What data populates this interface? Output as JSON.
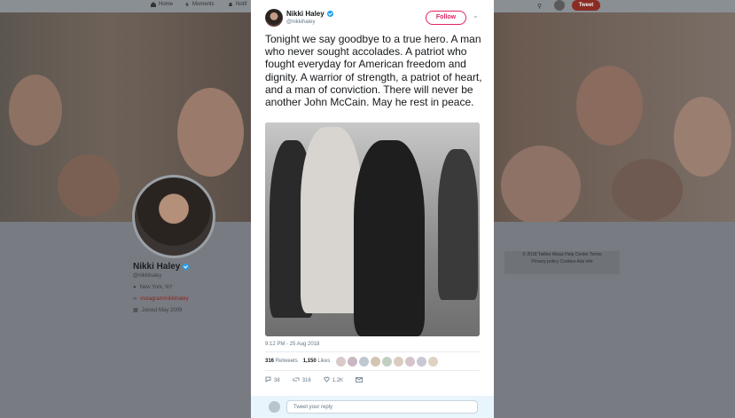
{
  "nav": {
    "home": "Home",
    "moments": "Moments",
    "notifications": "Notif",
    "tweet_button": "Tweet"
  },
  "profile": {
    "name": "Nikki Haley",
    "handle": "@nikkihaley",
    "location": "New York, NY",
    "link": "instagram/nikkihaley",
    "joined": "Joined May 2009"
  },
  "footer": {
    "line1": "© 2018 Twitter   About   Help Center   Terms",
    "line2": "Privacy policy   Cookies   Ads info"
  },
  "tweet": {
    "author_name": "Nikki Haley",
    "author_handle": "@nikkihaley",
    "follow_label": "Follow",
    "text": "Tonight we say goodbye to a true hero. A man who never sought accolades. A patriot who fought everyday for American freedom and dignity. A warrior of strength, a patriot of heart, and a man of conviction. There will never be another John McCain. May he rest in peace.",
    "timestamp": "9:12 PM - 25 Aug 2018",
    "retweets_count": "316",
    "retweets_label": "Retweets",
    "likes_count": "1,150",
    "likes_label": "Likes",
    "replies": "38",
    "retweets_action": "316",
    "likes_action": "1.2K",
    "reply_placeholder": "Tweet your reply"
  },
  "colors": {
    "accent": "#e0245e",
    "verified": "#1da1f2",
    "nav_tweet": "#8a2b24"
  }
}
